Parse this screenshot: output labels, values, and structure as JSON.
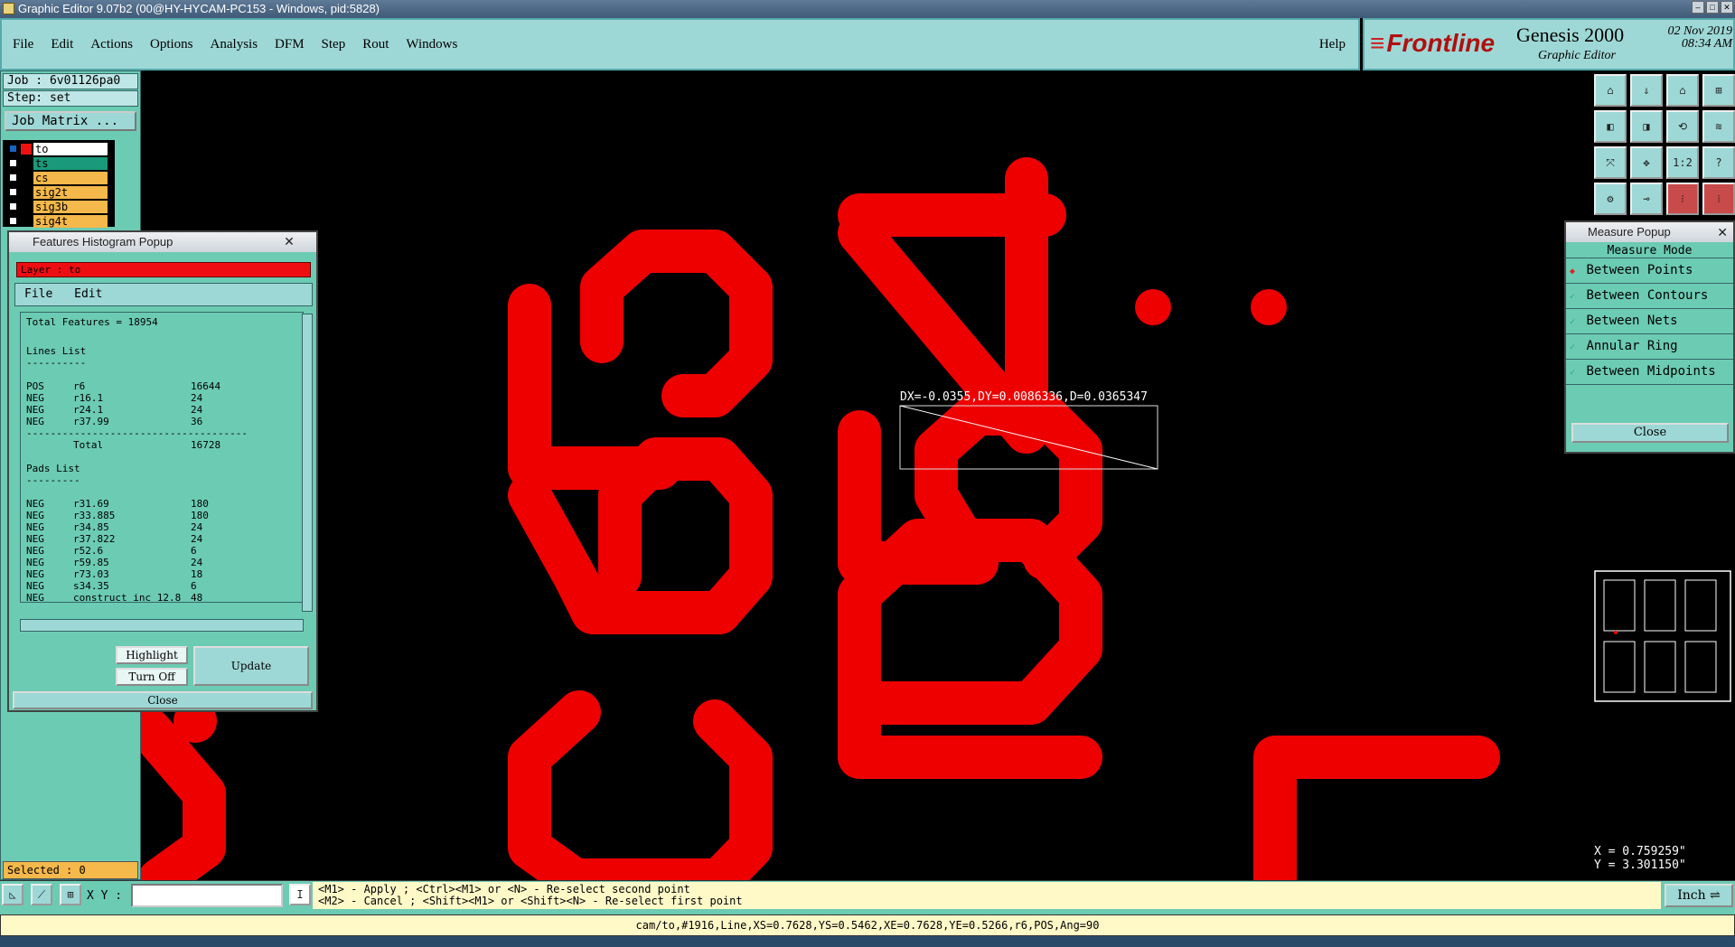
{
  "window": {
    "title": "Graphic Editor 9.07b2 (00@HY-HYCAM-PC153 - Windows, pid:5828)"
  },
  "menu": [
    "File",
    "Edit",
    "Actions",
    "Options",
    "Analysis",
    "DFM",
    "Step",
    "Rout",
    "Windows"
  ],
  "help": "Help",
  "brand": {
    "logo": "Frontline",
    "product": "Genesis 2000",
    "subtitle": "Graphic Editor",
    "date": "02 Nov 2019",
    "time": "08:34 AM"
  },
  "job": {
    "job": "Job : 6v01126pa0",
    "step": "Step: set",
    "matrix_button": "Job Matrix ..."
  },
  "layers": [
    {
      "name": "to",
      "color": "#ffffff",
      "swatch": "#ee1111"
    },
    {
      "name": "ts",
      "color": "#1a9a7a",
      "swatch": "#6ccbb3"
    },
    {
      "name": "cs",
      "color": "#f5b84a",
      "swatch": "#6ccbb3"
    },
    {
      "name": "sig2t",
      "color": "#f5b84a",
      "swatch": "#6ccbb3"
    },
    {
      "name": "sig3b",
      "color": "#f5b84a",
      "swatch": "#6ccbb3"
    },
    {
      "name": "sig4t",
      "color": "#f5b84a",
      "swatch": "#6ccbb3"
    }
  ],
  "selected": "Selected : 0",
  "histogram": {
    "title": "Features Histogram Popup",
    "layer": "Layer :  to",
    "menu": [
      "File",
      "Edit"
    ],
    "total": "Total Features = 18954",
    "lines_header": "Lines List",
    "lines": [
      {
        "pol": "POS",
        "sym": "r6",
        "count": "16644"
      },
      {
        "pol": "NEG",
        "sym": "r16.1",
        "count": "24"
      },
      {
        "pol": "NEG",
        "sym": "r24.1",
        "count": "24"
      },
      {
        "pol": "NEG",
        "sym": "r37.99",
        "count": "36"
      }
    ],
    "total_label": "Total",
    "total_value": "16728",
    "pads_header": "Pads List",
    "pads": [
      {
        "pol": "NEG",
        "sym": "r31.69",
        "count": "180"
      },
      {
        "pol": "NEG",
        "sym": "r33.885",
        "count": "180"
      },
      {
        "pol": "NEG",
        "sym": "r34.85",
        "count": "24"
      },
      {
        "pol": "NEG",
        "sym": "r37.822",
        "count": "24"
      },
      {
        "pol": "NEG",
        "sym": "r52.6",
        "count": "6"
      },
      {
        "pol": "NEG",
        "sym": "r59.85",
        "count": "24"
      },
      {
        "pol": "NEG",
        "sym": "r73.03",
        "count": "18"
      },
      {
        "pol": "NEG",
        "sym": "s34.35",
        "count": "6"
      },
      {
        "pol": "NEG",
        "sym": "construct_inc_12.8",
        "count": "48"
      }
    ],
    "buttons": {
      "highlight": "Highlight",
      "turn_off": "Turn Off",
      "update": "Update",
      "close": "Close"
    }
  },
  "measure": {
    "title": "Measure Popup",
    "mode": "Measure Mode",
    "options": [
      "Between Points",
      "Between Contours",
      "Between Nets",
      "Annular Ring",
      "Between Midpoints"
    ],
    "selected_option": 0,
    "close": "Close",
    "readout": "DX=-0.0355,DY=0.0086336,D=0.0365347"
  },
  "coords": {
    "x": "X = 0.759259\"",
    "y": "Y = 3.301150\""
  },
  "xy_label": "X Y :",
  "hints": [
    "<M1> - Apply  ; <Ctrl><M1> or <N> - Re-select second point",
    "<M2> - Cancel ; <Shift><M1> or <Shift><N> - Re-select first point"
  ],
  "units": "Inch",
  "status": "cam/to,#1916,Line,XS=0.7628,YS=0.5462,XE=0.7628,YE=0.5266,r6,POS,Ang=90",
  "colors": {
    "accent": "#9ed8d6",
    "panel": "#6ccbb3",
    "copper": "#ee0000"
  }
}
